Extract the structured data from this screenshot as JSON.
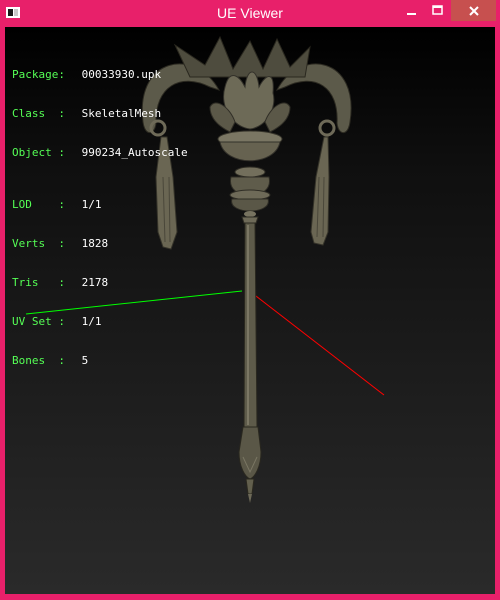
{
  "window": {
    "title": "UE Viewer",
    "icons": {
      "app": "app-icon",
      "minimize": "minimize-icon",
      "maximize": "maximize-icon",
      "close": "close-icon"
    }
  },
  "overlay": {
    "info": [
      {
        "label": "Package:",
        "value": "00033930.upk"
      },
      {
        "label": "Class  :",
        "value": "SkeletalMesh"
      },
      {
        "label": "Object :",
        "value": "990234_Autoscale"
      }
    ],
    "stats": [
      {
        "label": "LOD    :",
        "value": "1/1"
      },
      {
        "label": "Verts  :",
        "value": "1828"
      },
      {
        "label": "Tris   :",
        "value": "2178"
      },
      {
        "label": "UV Set :",
        "value": "1/1"
      },
      {
        "label": "Bones  :",
        "value": "5"
      }
    ]
  },
  "colors": {
    "frame": "#e8206a",
    "close_button": "#c7504f",
    "label_text": "#55ff55",
    "value_text": "#ffffff",
    "axis_x": "#ff0000",
    "axis_y": "#00ff00",
    "axis_z": "#0000ff",
    "mesh": "#6e6a58"
  }
}
